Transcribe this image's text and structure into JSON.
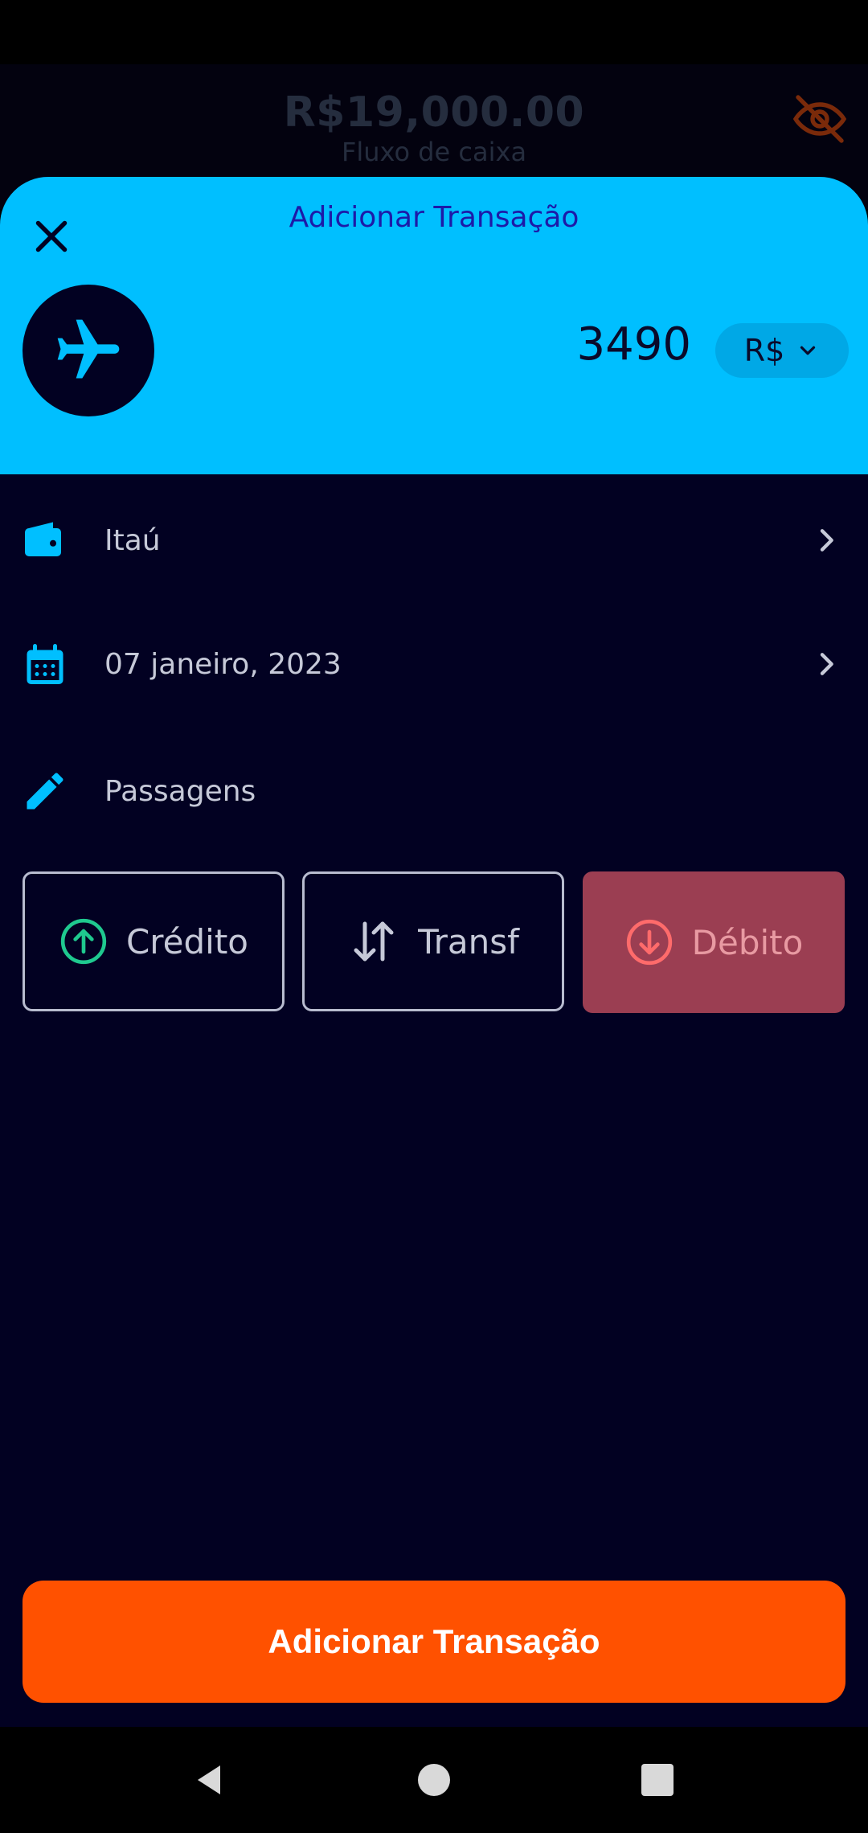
{
  "background": {
    "balance": "R$19,000.00",
    "balance_label": "Fluxo de caixa",
    "visibility_icon": "eye-off-icon"
  },
  "sheet": {
    "title": "Adicionar Transação",
    "close_icon": "close-icon",
    "category_icon": "airplane-icon",
    "amount": "3490",
    "currency": "R$"
  },
  "fields": {
    "account": "Itaú",
    "date": "07 janeiro, 2023",
    "description": "Passagens"
  },
  "transaction_types": [
    {
      "label": "Crédito",
      "icon": "arrow-up-circle-icon",
      "selected": false
    },
    {
      "label": "Transf",
      "icon": "swap-vertical-icon",
      "selected": false
    },
    {
      "label": "Débito",
      "icon": "arrow-down-circle-icon",
      "selected": true
    }
  ],
  "primary_button": "Adicionar Transação",
  "colors": {
    "accent": "#00bfff",
    "primary": "#ff5100",
    "background": "#020122",
    "credit": "#1fc98f",
    "debit": "#ff6b6b",
    "debit_selected_bg": "#9b3e52"
  }
}
